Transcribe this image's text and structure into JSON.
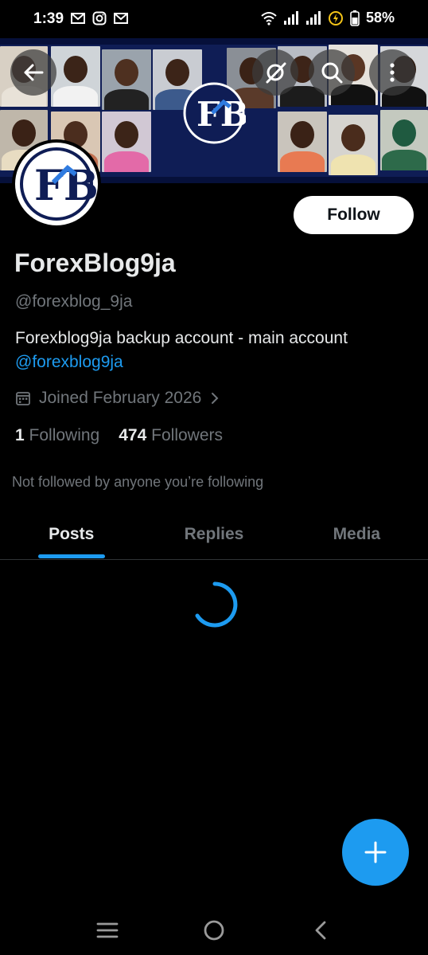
{
  "status_bar": {
    "time": "1:39",
    "battery": "58%",
    "notification_icons": [
      "gmail-icon",
      "instagram-icon",
      "gmail-icon"
    ]
  },
  "header": {
    "back_icon": "arrow-left-icon",
    "actions": [
      "grok-icon",
      "search-icon",
      "more-vertical-icon"
    ],
    "banner_logo_text": "FB"
  },
  "profile": {
    "avatar_text": "FB",
    "follow_label": "Follow",
    "display_name": "ForexBlog9ja",
    "handle": "@forexblog_9ja",
    "bio_text": "Forexblog9ja backup account - main account",
    "bio_link": "@forexblog9ja",
    "joined": "Joined February 2026",
    "following_count": "1",
    "following_label": "Following",
    "followers_count": "474",
    "followers_label": "Followers",
    "not_followed": "Not followed by anyone you’re following"
  },
  "tabs": [
    {
      "label": "Posts",
      "active": true
    },
    {
      "label": "Replies",
      "active": false
    },
    {
      "label": "Media",
      "active": false
    }
  ],
  "fab": {
    "icon": "plus-icon"
  },
  "nav_bar": [
    "recents-icon",
    "home-icon",
    "back-icon"
  ],
  "colors": {
    "accent": "#1d9bf0",
    "background": "#000000",
    "banner": "#0f1d55",
    "muted_text": "#71767b"
  }
}
